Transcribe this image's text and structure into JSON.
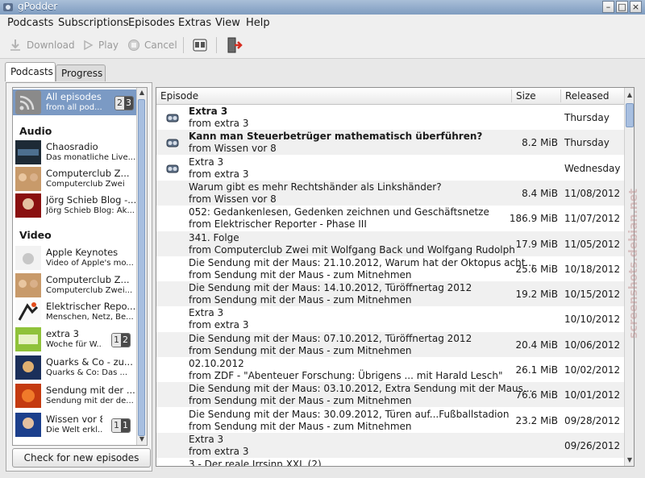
{
  "window": {
    "title": "gPodder"
  },
  "menu": [
    "Podcasts",
    "Subscriptions",
    "Episodes",
    "Extras",
    "View",
    "Help"
  ],
  "toolbar": {
    "download": "Download",
    "play": "Play",
    "cancel": "Cancel"
  },
  "tabs": {
    "podcasts": "Podcasts",
    "progress": "Progress"
  },
  "sidebar": {
    "all_episodes": {
      "name": "All episodes",
      "desc": "from all pod...",
      "new": "2",
      "downloaded": "3"
    },
    "sections": {
      "audio": "Audio",
      "video": "Video"
    },
    "audio": [
      {
        "name": "Chaosradio",
        "desc": "Das monatliche Live..."
      },
      {
        "name": "Computerclub Z...",
        "desc": "Computerclub Zwei"
      },
      {
        "name": "Jörg Schieb Blog -...",
        "desc": "Jörg Schieb Blog: Ak..."
      }
    ],
    "video": [
      {
        "name": "Apple Keynotes",
        "desc": "Video of Apple's mo..."
      },
      {
        "name": "Computerclub Z...",
        "desc": "Computerclub Zwei..."
      },
      {
        "name": "Elektrischer Repo...",
        "desc": "Menschen, Netz, Be..."
      },
      {
        "name": "extra 3",
        "desc": "Woche für W...",
        "new": "1",
        "downloaded": "2"
      },
      {
        "name": "Quarks & Co - zu...",
        "desc": "Quarks & Co: Das ..."
      },
      {
        "name": "Sendung mit der ...",
        "desc": "Sendung mit der de..."
      },
      {
        "name": "Wissen vor 8",
        "desc": "Die Welt erkl...",
        "new": "1",
        "downloaded": "1"
      }
    ],
    "check_button": "Check for new episodes"
  },
  "episode_table": {
    "headers": {
      "episode": "Episode",
      "size": "Size",
      "released": "Released"
    },
    "rows": [
      {
        "title": "Extra 3",
        "sub": "from extra 3",
        "size": "",
        "released": "Thursday",
        "bold": true,
        "icon": true
      },
      {
        "title": "Kann man Steuerbetrüger mathematisch überführen?",
        "sub": "from Wissen vor 8",
        "size": "8.2 MiB",
        "released": "Thursday",
        "bold": true,
        "icon": true
      },
      {
        "title": "Extra 3",
        "sub": "from extra 3",
        "size": "",
        "released": "Wednesday",
        "bold": false,
        "icon": true
      },
      {
        "title": "Warum gibt es mehr Rechtshänder als Linkshänder?",
        "sub": "from Wissen vor 8",
        "size": "8.4 MiB",
        "released": "11/08/2012",
        "bold": false,
        "icon": false
      },
      {
        "title": "052: Gedankenlesen, Gedenken zeichnen und Geschäftsnetze",
        "sub": "from Elektrischer Reporter - Phase III",
        "size": "186.9 MiB",
        "released": "11/07/2012",
        "bold": false,
        "icon": false
      },
      {
        "title": "341. Folge",
        "sub": "from Computerclub Zwei mit Wolfgang Back und Wolfgang Rudolph",
        "size": "17.9 MiB",
        "released": "11/05/2012",
        "bold": false,
        "icon": false
      },
      {
        "title": "Die Sendung mit der Maus: 21.10.2012, Warum hat der Oktopus acht...",
        "sub": "from Sendung mit der Maus - zum Mitnehmen",
        "size": "25.6 MiB",
        "released": "10/18/2012",
        "bold": false,
        "icon": false
      },
      {
        "title": "Die Sendung mit der Maus: 14.10.2012, Türöffnertag 2012",
        "sub": "from Sendung mit der Maus - zum Mitnehmen",
        "size": "19.2 MiB",
        "released": "10/15/2012",
        "bold": false,
        "icon": false
      },
      {
        "title": "Extra 3",
        "sub": "from extra 3",
        "size": "",
        "released": "10/10/2012",
        "bold": false,
        "icon": false
      },
      {
        "title": "Die Sendung mit der Maus: 07.10.2012, Türöffnertag 2012",
        "sub": "from Sendung mit der Maus - zum Mitnehmen",
        "size": "20.4 MiB",
        "released": "10/06/2012",
        "bold": false,
        "icon": false
      },
      {
        "title": "02.10.2012",
        "sub": "from ZDF - \"Abenteuer Forschung: Übrigens ... mit Harald Lesch\"",
        "size": "26.1 MiB",
        "released": "10/02/2012",
        "bold": false,
        "icon": false
      },
      {
        "title": "Die Sendung mit der Maus: 03.10.2012, Extra Sendung mit der Maus...",
        "sub": "from Sendung mit der Maus - zum Mitnehmen",
        "size": "76.6 MiB",
        "released": "10/01/2012",
        "bold": false,
        "icon": false
      },
      {
        "title": "Die Sendung mit der Maus: 30.09.2012, Türen auf...Fußballstadion",
        "sub": "from Sendung mit der Maus - zum Mitnehmen",
        "size": "23.2 MiB",
        "released": "09/28/2012",
        "bold": false,
        "icon": false
      },
      {
        "title": "Extra 3",
        "sub": "from extra 3",
        "size": "",
        "released": "09/26/2012",
        "bold": false,
        "icon": false
      },
      {
        "title": "3 - Der reale Irrsinn XXL (2)",
        "sub": "",
        "size": "",
        "released": "",
        "bold": false,
        "icon": false
      }
    ]
  },
  "watermark": "screenshots.debian.net"
}
